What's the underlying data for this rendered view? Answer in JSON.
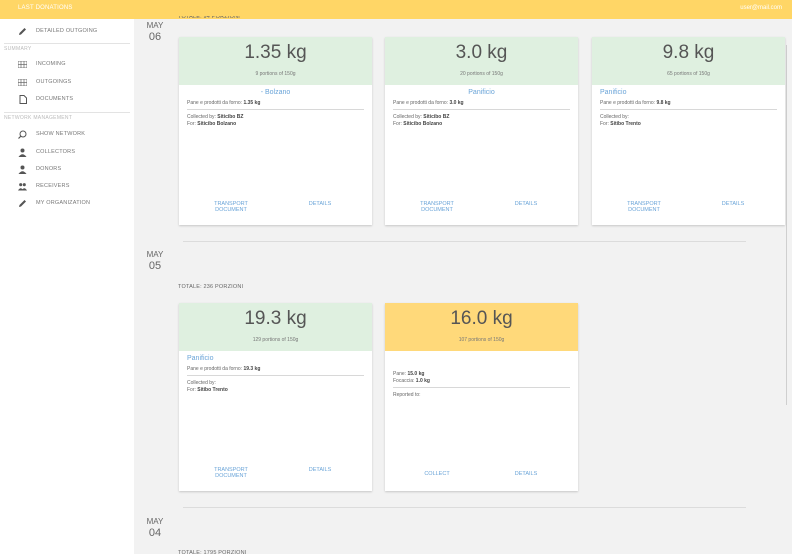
{
  "topbar": {
    "title": "LAST DONATIONS",
    "user": "user@mail.com"
  },
  "sidebar": {
    "items_top": [
      {
        "label": "DETAILED OUTGOING",
        "icon": "pencil-icon"
      }
    ],
    "summary_heading": "SUMMARY",
    "summary": [
      {
        "label": "INCOMING",
        "icon": "table-icon"
      },
      {
        "label": "OUTGOINGS",
        "icon": "table-icon"
      },
      {
        "label": "DOCUMENTS",
        "icon": "document-icon"
      }
    ],
    "network_heading": "NETWORK MANAGEMENT",
    "network": [
      {
        "label": "SHOW NETWORK",
        "icon": "search-icon"
      },
      {
        "label": "COLLECTORS",
        "icon": "person-icon"
      },
      {
        "label": "DONORS",
        "icon": "person-icon"
      },
      {
        "label": "RECEIVERS",
        "icon": "group-icon"
      },
      {
        "label": "MY ORGANIZATION",
        "icon": "pencil-icon"
      }
    ]
  },
  "days": [
    {
      "month": "MAY",
      "day": "06",
      "total": "TOTALE: 94 PORZIONI",
      "cards": [
        {
          "kg": "1.35 kg",
          "portions": "9 portions of 150g",
          "name": "- Bolzano",
          "product_label": "Pane e prodotti da forno: ",
          "product_value": "1.35 kg",
          "collected_label": "Collected by: ",
          "collected_value": "Siticibo BZ",
          "for_label": "For: ",
          "for_value": "Siticibo Bolzano",
          "action1": "TRANSPORT DOCUMENT",
          "action2": "DETAILS"
        },
        {
          "kg": "3.0 kg",
          "portions": "20 portions of 150g",
          "name": "Panificio",
          "product_label": "Pane e prodotti da forno: ",
          "product_value": "3.0 kg",
          "collected_label": "Collected by: ",
          "collected_value": "Siticibo BZ",
          "for_label": "For: ",
          "for_value": "Siticibo Bolzano",
          "action1": "TRANSPORT DOCUMENT",
          "action2": "DETAILS"
        },
        {
          "kg": "9.8 kg",
          "portions": "65 portions of 150g",
          "name": "Panificio",
          "product_label": "Pane e prodotti da forno: ",
          "product_value": "9.8 kg",
          "collected_label": "Collected by:",
          "collected_value": "",
          "for_label": "For: ",
          "for_value": "Sitibo Trento",
          "action1": "TRANSPORT DOCUMENT",
          "action2": "DETAILS"
        }
      ]
    },
    {
      "month": "MAY",
      "day": "05",
      "total": "TOTALE: 236 PORZIONI",
      "cards": [
        {
          "kg": "19.3 kg",
          "portions": "129 portions of 150g",
          "name": "Panificio",
          "product_label": "Pane e prodotti da forno: ",
          "product_value": "19.3 kg",
          "collected_label": "Collected by:",
          "collected_value": "",
          "for_label": "For: ",
          "for_value": "Sitibo Trento",
          "action1": "TRANSPORT DOCUMENT",
          "action2": "DETAILS"
        },
        {
          "kg": "16.0 kg",
          "portions": "107 portions of 150g",
          "pane_label": "Pane: ",
          "pane_value": "15.0 kg",
          "focaccia_label": "Focaccia: ",
          "focaccia_value": "1.0 kg",
          "reported_label": "Reported to:",
          "action1": "COLLECT",
          "action2": "DETAILS"
        }
      ]
    },
    {
      "month": "MAY",
      "day": "04",
      "total": "TOTALE: 1795 PORZIONI"
    }
  ],
  "colors": {
    "topbar": "#ffd666",
    "card_green": "#dff0e0",
    "card_yellow": "#ffd97a",
    "link": "#6aa4d8"
  }
}
